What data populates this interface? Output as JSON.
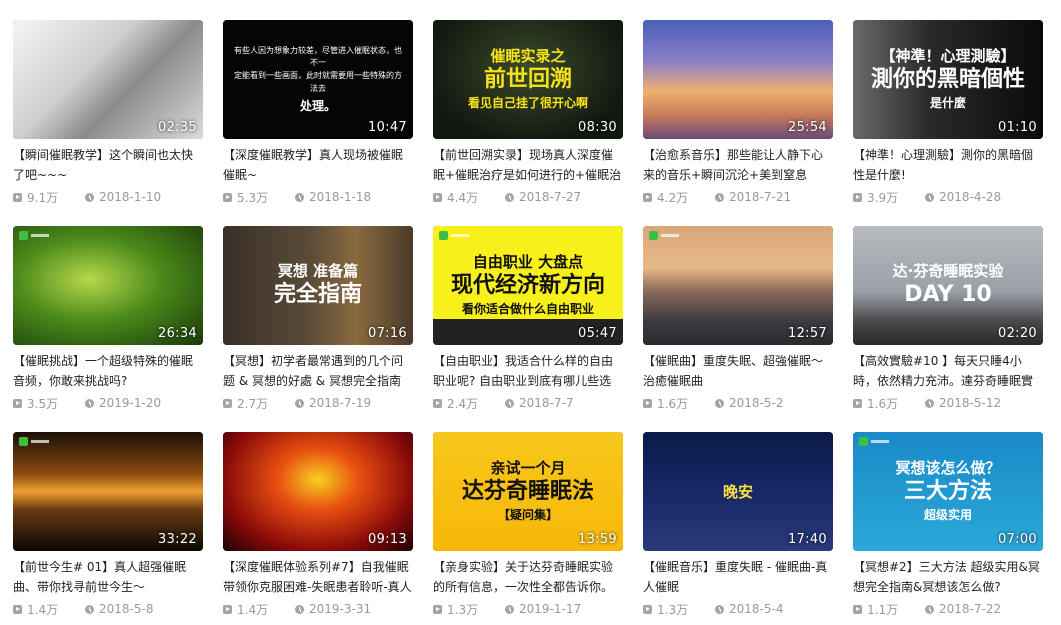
{
  "videos": [
    {
      "title": "【瞬间催眠教学】这个瞬间也太快了吧~~~",
      "duration": "02:35",
      "views": "9.1万",
      "date": "2018-1-10",
      "thumb": {
        "bg": "linear-gradient(135deg,#f4f4f4 0%,#cfcfcf 40%,#8a8a8a 60%,#dcdcdc 100%)",
        "overlay_lines": [],
        "overlay_color": "#000000"
      }
    },
    {
      "title": "【深度催眠教学】真人现场被催眠催眠~",
      "duration": "10:47",
      "views": "5.3万",
      "date": "2018-1-18",
      "thumb": {
        "bg": "#050505",
        "overlay_lines": [
          "有些人因为想象力较差，尽管进入催眠状态，也不一",
          "定能看到一些画面，此时就需要用一些特殊的方法去",
          "处理。"
        ],
        "overlay_color": "#ffffff",
        "small": true
      }
    },
    {
      "title": "【前世回溯实录】现场真人深度催眠+催眠治疗是如何进行的+催眠治",
      "duration": "08:30",
      "views": "4.4万",
      "date": "2018-7-27",
      "thumb": {
        "bg": "radial-gradient(ellipse at 50% 40%,#3a4a2a 0%,#121810 75%)",
        "overlay_lines": [
          "催眠实录之",
          "前世回溯",
          "看见自己挂了很开心啊"
        ],
        "overlay_color": "#f5e21a"
      }
    },
    {
      "title": "【治愈系音乐】那些能让人静下心来的音乐+瞬间沉沦+美到窒息",
      "duration": "25:54",
      "views": "4.2万",
      "date": "2018-7-21",
      "thumb": {
        "bg": "linear-gradient(180deg,#4a5fb8 0%,#8d7fc8 35%,#f0b070 60%,#c87a5a 80%,#6a4a7a 100%)",
        "overlay_lines": [],
        "overlay_color": "#ffffff"
      }
    },
    {
      "title": "【神準！心理測驗】測你的黑暗個性是什麼!",
      "duration": "01:10",
      "views": "3.9万",
      "date": "2018-4-28",
      "thumb": {
        "bg": "linear-gradient(90deg,#6a6a6a 0%,#2a2a2a 40%,#0a0a0a 100%)",
        "overlay_lines": [
          "【神準！心理測驗】",
          "測你的黑暗個性",
          "是什麼"
        ],
        "overlay_color": "#ffffff"
      }
    },
    {
      "title": "【催眠挑战】一个超级特殊的催眠音频，你敢来挑战吗?",
      "duration": "26:34",
      "views": "3.5万",
      "date": "2019-1-20",
      "thumb": {
        "bg": "radial-gradient(ellipse at 40% 45%,#b8d84a 0%,#4a8a1a 45%,#1a3a0a 100%)",
        "overlay_lines": [],
        "overlay_color": "#ffffff",
        "watermark": true
      }
    },
    {
      "title": "【冥想】初学者最常遇到的几个问题 & 冥想的好處 & 冥想完全指南",
      "duration": "07:16",
      "views": "2.7万",
      "date": "2018-7-19",
      "thumb": {
        "bg": "linear-gradient(90deg,#3a3028 0%,#5a4a38 45%,#8a6a40 70%,#4a3a28 100%)",
        "overlay_lines": [
          "冥想 准备篇",
          "完全指南"
        ],
        "overlay_color": "#ffffff"
      }
    },
    {
      "title": "【自由职业】我适合什么样的自由职业呢? 自由职业到底有哪儿些选",
      "duration": "05:47",
      "views": "2.4万",
      "date": "2018-7-7",
      "thumb": {
        "bg": "linear-gradient(180deg,#f7f01a 0%,#f7f01a 78%,#222 78%,#222 100%)",
        "overlay_lines": [
          "自由职业 大盘点",
          "现代经济新方向",
          "看你适合做什么自由职业"
        ],
        "overlay_color": "#111111",
        "watermark": true
      }
    },
    {
      "title": "【催眠曲】重度失眠、超強催眠～治癒催眠曲",
      "duration": "12:57",
      "views": "1.6万",
      "date": "2018-5-2",
      "thumb": {
        "bg": "linear-gradient(180deg,#d8a878 0%,#e8b888 35%,#8a6a5a 55%,#3a3a40 80%,#2a2a30 100%)",
        "overlay_lines": [],
        "overlay_color": "#ffffff",
        "watermark": true
      }
    },
    {
      "title": "【高效實驗#10 】每天只睡4小時，依然精力充沛。達芬奇睡眠實",
      "duration": "02:20",
      "views": "1.6万",
      "date": "2018-5-12",
      "thumb": {
        "bg": "linear-gradient(180deg,#b8bcc0 0%,#9aa0a8 55%,#4a4a4a 80%,#2a2a2a 100%)",
        "overlay_lines": [
          "达·芬奇睡眠实验",
          "DAY 10"
        ],
        "overlay_color": "#ffffff"
      }
    },
    {
      "title": "【前世今生# 01】真人超强催眠曲、带你找寻前世今生～",
      "duration": "33:22",
      "views": "1.4万",
      "date": "2018-5-8",
      "thumb": {
        "bg": "linear-gradient(180deg,#1a1008 0%,#8a4a10 35%,#f0a030 50%,#6a3a10 65%,#0a0804 100%)",
        "overlay_lines": [],
        "overlay_color": "#ffffff",
        "watermark": true
      }
    },
    {
      "title": "【深度催眠体验系列#7】自我催眠带领你克服困难-失眠患者聆听-真人",
      "duration": "09:13",
      "views": "1.4万",
      "date": "2019-3-31",
      "thumb": {
        "bg": "radial-gradient(ellipse at 50% 40%,#f8d020 0%,#e85010 30%,#8a0a0a 70%,#1a0202 100%)",
        "overlay_lines": [],
        "overlay_color": "#ffffff"
      }
    },
    {
      "title": "【亲身实验】关于达芬奇睡眠实验的所有信息，一次性全都告诉你。",
      "duration": "13:59",
      "views": "1.3万",
      "date": "2019-1-17",
      "thumb": {
        "bg": "linear-gradient(180deg,#f7c81a 0%,#f7b80a 100%)",
        "overlay_lines": [
          "亲试一个月",
          "达芬奇睡眠法",
          "【疑问集】"
        ],
        "overlay_color": "#111111"
      }
    },
    {
      "title": "【催眠音乐】重度失眠 - 催眠曲-真人催眠",
      "duration": "17:40",
      "views": "1.3万",
      "date": "2018-5-4",
      "thumb": {
        "bg": "linear-gradient(180deg,#0a1a4a 0%,#1a2a6a 60%,#2a3a7a 100%)",
        "overlay_lines": [
          "晚安"
        ],
        "overlay_color": "#f7e040"
      }
    },
    {
      "title": "【冥想#2】三大方法 超级实用&冥想完全指南&冥想该怎么做?",
      "duration": "07:00",
      "views": "1.1万",
      "date": "2018-7-22",
      "thumb": {
        "bg": "linear-gradient(180deg,#1a8ac8 0%,#2aa8d8 100%)",
        "overlay_lines": [
          "冥想该怎么做？",
          "三大方法",
          "超级实用"
        ],
        "overlay_color": "#ffffff",
        "watermark": true
      }
    }
  ]
}
